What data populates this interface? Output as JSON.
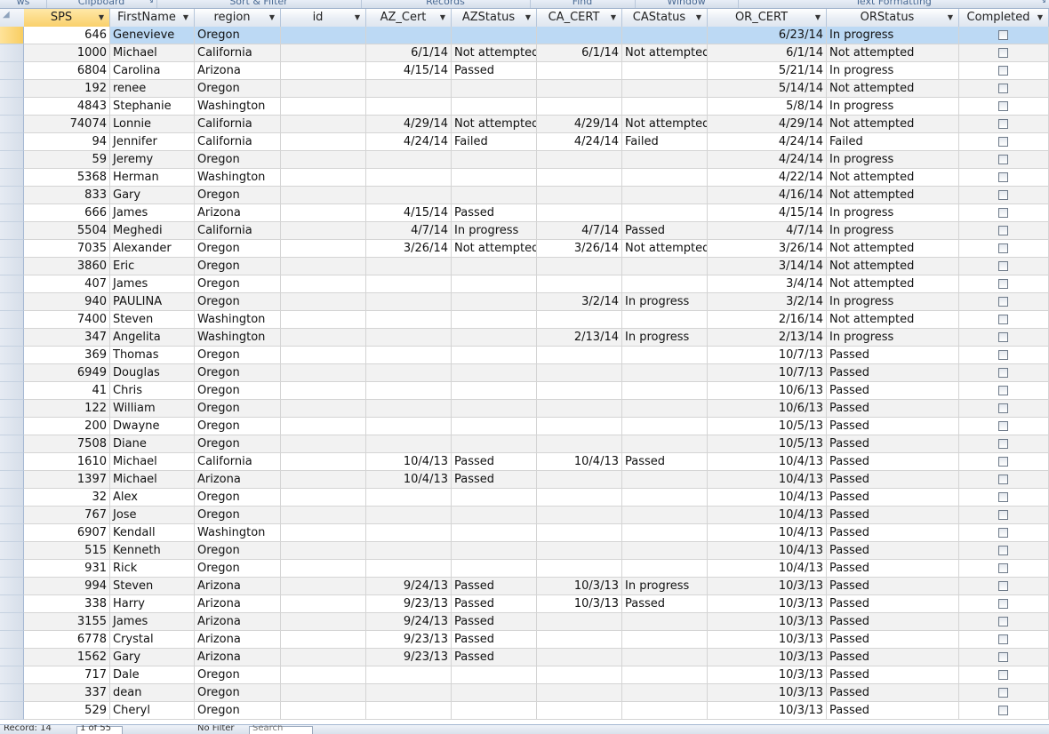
{
  "ribbon": {
    "groups": [
      {
        "label": "ws",
        "launcher": false
      },
      {
        "label": "Clipboard",
        "launcher": true
      },
      {
        "label": "Sort & Filter",
        "launcher": false
      },
      {
        "label": "Records",
        "launcher": false
      },
      {
        "label": "Find",
        "launcher": false
      },
      {
        "label": "Window",
        "launcher": false
      },
      {
        "label": "Text Formatting",
        "launcher": true
      }
    ],
    "launcher_glyph": "↘"
  },
  "columns": [
    {
      "label": "SPS"
    },
    {
      "label": "FirstName"
    },
    {
      "label": "region"
    },
    {
      "label": "id"
    },
    {
      "label": "AZ_Cert"
    },
    {
      "label": "AZStatus"
    },
    {
      "label": "CA_CERT"
    },
    {
      "label": "CAStatus"
    },
    {
      "label": "OR_CERT"
    },
    {
      "label": "ORStatus"
    },
    {
      "label": "Completed"
    }
  ],
  "selected_column_index": 0,
  "current_row_index": 0,
  "rows": [
    {
      "sps": "646",
      "first": "Genevieve",
      "region": "Oregon",
      "id": "",
      "az_cert": "",
      "az_status": "",
      "ca_cert": "",
      "ca_status": "",
      "or_cert": "6/23/14",
      "or_status": "In progress",
      "completed": false
    },
    {
      "sps": "1000",
      "first": "Michael",
      "region": "California",
      "id": "",
      "az_cert": "6/1/14",
      "az_status": "Not attempted",
      "ca_cert": "6/1/14",
      "ca_status": "Not attempted",
      "or_cert": "6/1/14",
      "or_status": "Not attempted",
      "completed": false
    },
    {
      "sps": "6804",
      "first": "Carolina",
      "region": "Arizona",
      "id": "",
      "az_cert": "4/15/14",
      "az_status": "Passed",
      "ca_cert": "",
      "ca_status": "",
      "or_cert": "5/21/14",
      "or_status": "In progress",
      "completed": false
    },
    {
      "sps": "192",
      "first": "renee",
      "region": "Oregon",
      "id": "",
      "az_cert": "",
      "az_status": "",
      "ca_cert": "",
      "ca_status": "",
      "or_cert": "5/14/14",
      "or_status": "Not attempted",
      "completed": false
    },
    {
      "sps": "4843",
      "first": "Stephanie",
      "region": "Washington",
      "id": "",
      "az_cert": "",
      "az_status": "",
      "ca_cert": "",
      "ca_status": "",
      "or_cert": "5/8/14",
      "or_status": "In progress",
      "completed": false
    },
    {
      "sps": "74074",
      "first": "Lonnie",
      "region": "California",
      "id": "",
      "az_cert": "4/29/14",
      "az_status": "Not attempted",
      "ca_cert": "4/29/14",
      "ca_status": "Not attempted",
      "or_cert": "4/29/14",
      "or_status": "Not attempted",
      "completed": false
    },
    {
      "sps": "94",
      "first": "Jennifer",
      "region": "California",
      "id": "",
      "az_cert": "4/24/14",
      "az_status": "Failed",
      "ca_cert": "4/24/14",
      "ca_status": "Failed",
      "or_cert": "4/24/14",
      "or_status": "Failed",
      "completed": false
    },
    {
      "sps": "59",
      "first": "Jeremy",
      "region": "Oregon",
      "id": "",
      "az_cert": "",
      "az_status": "",
      "ca_cert": "",
      "ca_status": "",
      "or_cert": "4/24/14",
      "or_status": "In progress",
      "completed": false
    },
    {
      "sps": "5368",
      "first": "Herman",
      "region": "Washington",
      "id": "",
      "az_cert": "",
      "az_status": "",
      "ca_cert": "",
      "ca_status": "",
      "or_cert": "4/22/14",
      "or_status": "Not attempted",
      "completed": false
    },
    {
      "sps": "833",
      "first": "Gary",
      "region": "Oregon",
      "id": "",
      "az_cert": "",
      "az_status": "",
      "ca_cert": "",
      "ca_status": "",
      "or_cert": "4/16/14",
      "or_status": "Not attempted",
      "completed": false
    },
    {
      "sps": "666",
      "first": "James",
      "region": "Arizona",
      "id": "",
      "az_cert": "4/15/14",
      "az_status": "Passed",
      "ca_cert": "",
      "ca_status": "",
      "or_cert": "4/15/14",
      "or_status": "In progress",
      "completed": false
    },
    {
      "sps": "5504",
      "first": "Meghedi",
      "region": "California",
      "id": "",
      "az_cert": "4/7/14",
      "az_status": "In progress",
      "ca_cert": "4/7/14",
      "ca_status": "Passed",
      "or_cert": "4/7/14",
      "or_status": "In progress",
      "completed": false
    },
    {
      "sps": "7035",
      "first": "Alexander",
      "region": "Oregon",
      "id": "",
      "az_cert": "3/26/14",
      "az_status": "Not attempted",
      "ca_cert": "3/26/14",
      "ca_status": "Not attempted",
      "or_cert": "3/26/14",
      "or_status": "Not attempted",
      "completed": false
    },
    {
      "sps": "3860",
      "first": "Eric",
      "region": "Oregon",
      "id": "",
      "az_cert": "",
      "az_status": "",
      "ca_cert": "",
      "ca_status": "",
      "or_cert": "3/14/14",
      "or_status": "Not attempted",
      "completed": false
    },
    {
      "sps": "407",
      "first": "James",
      "region": "Oregon",
      "id": "",
      "az_cert": "",
      "az_status": "",
      "ca_cert": "",
      "ca_status": "",
      "or_cert": "3/4/14",
      "or_status": "Not attempted",
      "completed": false
    },
    {
      "sps": "940",
      "first": "PAULINA",
      "region": "Oregon",
      "id": "",
      "az_cert": "",
      "az_status": "",
      "ca_cert": "3/2/14",
      "ca_status": "In progress",
      "or_cert": "3/2/14",
      "or_status": "In progress",
      "completed": false
    },
    {
      "sps": "7400",
      "first": "Steven",
      "region": "Washington",
      "id": "",
      "az_cert": "",
      "az_status": "",
      "ca_cert": "",
      "ca_status": "",
      "or_cert": "2/16/14",
      "or_status": "Not attempted",
      "completed": false
    },
    {
      "sps": "347",
      "first": "Angelita",
      "region": "Washington",
      "id": "",
      "az_cert": "",
      "az_status": "",
      "ca_cert": "2/13/14",
      "ca_status": "In progress",
      "or_cert": "2/13/14",
      "or_status": "In progress",
      "completed": false
    },
    {
      "sps": "369",
      "first": "Thomas",
      "region": "Oregon",
      "id": "",
      "az_cert": "",
      "az_status": "",
      "ca_cert": "",
      "ca_status": "",
      "or_cert": "10/7/13",
      "or_status": "Passed",
      "completed": false
    },
    {
      "sps": "6949",
      "first": "Douglas",
      "region": "Oregon",
      "id": "",
      "az_cert": "",
      "az_status": "",
      "ca_cert": "",
      "ca_status": "",
      "or_cert": "10/7/13",
      "or_status": "Passed",
      "completed": false
    },
    {
      "sps": "41",
      "first": "Chris",
      "region": "Oregon",
      "id": "",
      "az_cert": "",
      "az_status": "",
      "ca_cert": "",
      "ca_status": "",
      "or_cert": "10/6/13",
      "or_status": "Passed",
      "completed": false
    },
    {
      "sps": "122",
      "first": "William",
      "region": "Oregon",
      "id": "",
      "az_cert": "",
      "az_status": "",
      "ca_cert": "",
      "ca_status": "",
      "or_cert": "10/6/13",
      "or_status": "Passed",
      "completed": false
    },
    {
      "sps": "200",
      "first": "Dwayne",
      "region": "Oregon",
      "id": "",
      "az_cert": "",
      "az_status": "",
      "ca_cert": "",
      "ca_status": "",
      "or_cert": "10/5/13",
      "or_status": "Passed",
      "completed": false
    },
    {
      "sps": "7508",
      "first": "Diane",
      "region": "Oregon",
      "id": "",
      "az_cert": "",
      "az_status": "",
      "ca_cert": "",
      "ca_status": "",
      "or_cert": "10/5/13",
      "or_status": "Passed",
      "completed": false
    },
    {
      "sps": "1610",
      "first": "Michael",
      "region": "California",
      "id": "",
      "az_cert": "10/4/13",
      "az_status": "Passed",
      "ca_cert": "10/4/13",
      "ca_status": "Passed",
      "or_cert": "10/4/13",
      "or_status": "Passed",
      "completed": false
    },
    {
      "sps": "1397",
      "first": "Michael",
      "region": "Arizona",
      "id": "",
      "az_cert": "10/4/13",
      "az_status": "Passed",
      "ca_cert": "",
      "ca_status": "",
      "or_cert": "10/4/13",
      "or_status": "Passed",
      "completed": false
    },
    {
      "sps": "32",
      "first": "Alex",
      "region": "Oregon",
      "id": "",
      "az_cert": "",
      "az_status": "",
      "ca_cert": "",
      "ca_status": "",
      "or_cert": "10/4/13",
      "or_status": "Passed",
      "completed": false
    },
    {
      "sps": "767",
      "first": "Jose",
      "region": "Oregon",
      "id": "",
      "az_cert": "",
      "az_status": "",
      "ca_cert": "",
      "ca_status": "",
      "or_cert": "10/4/13",
      "or_status": "Passed",
      "completed": false
    },
    {
      "sps": "6907",
      "first": "Kendall",
      "region": "Washington",
      "id": "",
      "az_cert": "",
      "az_status": "",
      "ca_cert": "",
      "ca_status": "",
      "or_cert": "10/4/13",
      "or_status": "Passed",
      "completed": false
    },
    {
      "sps": "515",
      "first": "Kenneth",
      "region": "Oregon",
      "id": "",
      "az_cert": "",
      "az_status": "",
      "ca_cert": "",
      "ca_status": "",
      "or_cert": "10/4/13",
      "or_status": "Passed",
      "completed": false
    },
    {
      "sps": "931",
      "first": "Rick",
      "region": "Oregon",
      "id": "",
      "az_cert": "",
      "az_status": "",
      "ca_cert": "",
      "ca_status": "",
      "or_cert": "10/4/13",
      "or_status": "Passed",
      "completed": false
    },
    {
      "sps": "994",
      "first": "Steven",
      "region": "Arizona",
      "id": "",
      "az_cert": "9/24/13",
      "az_status": "Passed",
      "ca_cert": "10/3/13",
      "ca_status": "In progress",
      "or_cert": "10/3/13",
      "or_status": "Passed",
      "completed": false
    },
    {
      "sps": "338",
      "first": "Harry",
      "region": "Arizona",
      "id": "",
      "az_cert": "9/23/13",
      "az_status": "Passed",
      "ca_cert": "10/3/13",
      "ca_status": "Passed",
      "or_cert": "10/3/13",
      "or_status": "Passed",
      "completed": false
    },
    {
      "sps": "3155",
      "first": "James",
      "region": "Arizona",
      "id": "",
      "az_cert": "9/24/13",
      "az_status": "Passed",
      "ca_cert": "",
      "ca_status": "",
      "or_cert": "10/3/13",
      "or_status": "Passed",
      "completed": false
    },
    {
      "sps": "6778",
      "first": "Crystal",
      "region": "Arizona",
      "id": "",
      "az_cert": "9/23/13",
      "az_status": "Passed",
      "ca_cert": "",
      "ca_status": "",
      "or_cert": "10/3/13",
      "or_status": "Passed",
      "completed": false
    },
    {
      "sps": "1562",
      "first": "Gary",
      "region": "Arizona",
      "id": "",
      "az_cert": "9/23/13",
      "az_status": "Passed",
      "ca_cert": "",
      "ca_status": "",
      "or_cert": "10/3/13",
      "or_status": "Passed",
      "completed": false
    },
    {
      "sps": "717",
      "first": "Dale",
      "region": "Oregon",
      "id": "",
      "az_cert": "",
      "az_status": "",
      "ca_cert": "",
      "ca_status": "",
      "or_cert": "10/3/13",
      "or_status": "Passed",
      "completed": false
    },
    {
      "sps": "337",
      "first": "dean",
      "region": "Oregon",
      "id": "",
      "az_cert": "",
      "az_status": "",
      "ca_cert": "",
      "ca_status": "",
      "or_cert": "10/3/13",
      "or_status": "Passed",
      "completed": false
    },
    {
      "sps": "529",
      "first": "Cheryl",
      "region": "Oregon",
      "id": "",
      "az_cert": "",
      "az_status": "",
      "ca_cert": "",
      "ca_status": "",
      "or_cert": "10/3/13",
      "or_status": "Passed",
      "completed": false
    }
  ],
  "navigation": {
    "record_label": "Record: 14",
    "record_position": "1 of 55",
    "filter_label": "No Filter",
    "search_placeholder": "Search"
  },
  "colors": {
    "current_row": "#bcd9f4",
    "alt_row": "#f2f2f2",
    "selected_header": "#f9d06b",
    "grid_line": "#d4d4d4"
  },
  "icons": {
    "sort_dropdown": "dropdown-arrow-icon",
    "record_selector": "row-selector-icon",
    "completed": "checkbox-icon"
  }
}
